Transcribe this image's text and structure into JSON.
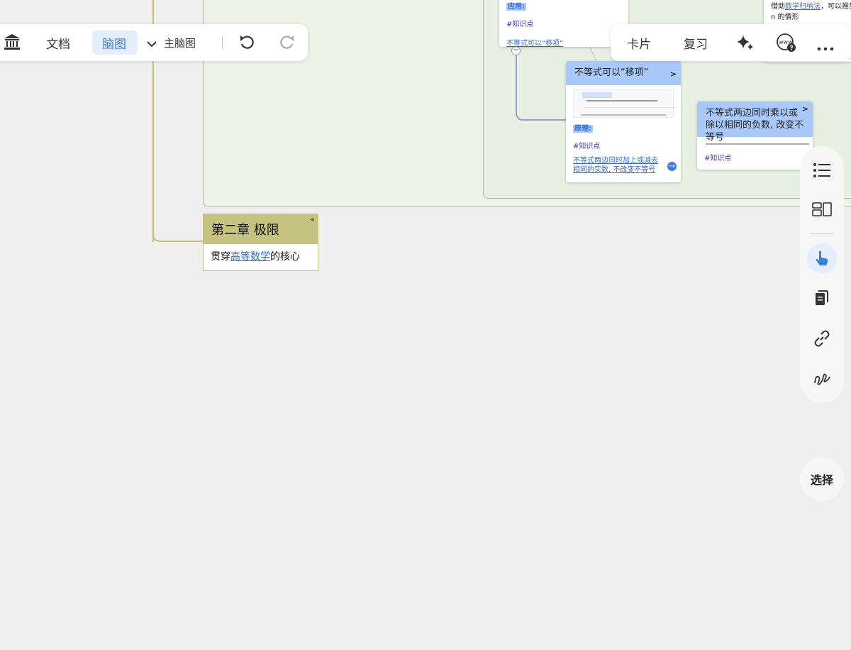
{
  "toolbar": {
    "doc_label": "文档",
    "mindmap_label": "脑图",
    "main_map_label": "主脑图"
  },
  "toolbar_right": {
    "card_label": "卡片",
    "review_label": "复习"
  },
  "top_card": {
    "apply_label": "应用:",
    "tag": "#知识点",
    "link": "不等式可以“移项”"
  },
  "right_edge_card": {
    "line1_prefix": "借助",
    "line1_link": "数学归纳法",
    "line1_suffix": "，可以推到",
    "line2": "n 的情形"
  },
  "card_move": {
    "title": "不等式可以“移项”",
    "principle_label": "原理:",
    "tag": "#知识点",
    "link": "不等式两边同时加上或减去相同的实数, 不改变不等号"
  },
  "card_negative": {
    "title": "不等式两边同时乘以或除以相同的负数, 改变不等号",
    "tag": "#知识点"
  },
  "chapter": {
    "title": "第二章 极限",
    "body_prefix": "贯穿",
    "body_link": "高等数学",
    "body_suffix": "的核心"
  },
  "side_panel": {
    "select_label": "选择"
  },
  "colors": {
    "accent_blue": "#3b7fe0",
    "card_header": "#aac9fb",
    "chapter_header": "#c6c380"
  },
  "icons": [
    "bank-icon",
    "chevron-down-icon",
    "undo-icon",
    "redo-icon",
    "sparkle-icon",
    "web-help-icon",
    "more-icon",
    "list-icon",
    "layout-icon",
    "pointer-icon",
    "copy-icon",
    "link-icon",
    "scribble-icon"
  ]
}
